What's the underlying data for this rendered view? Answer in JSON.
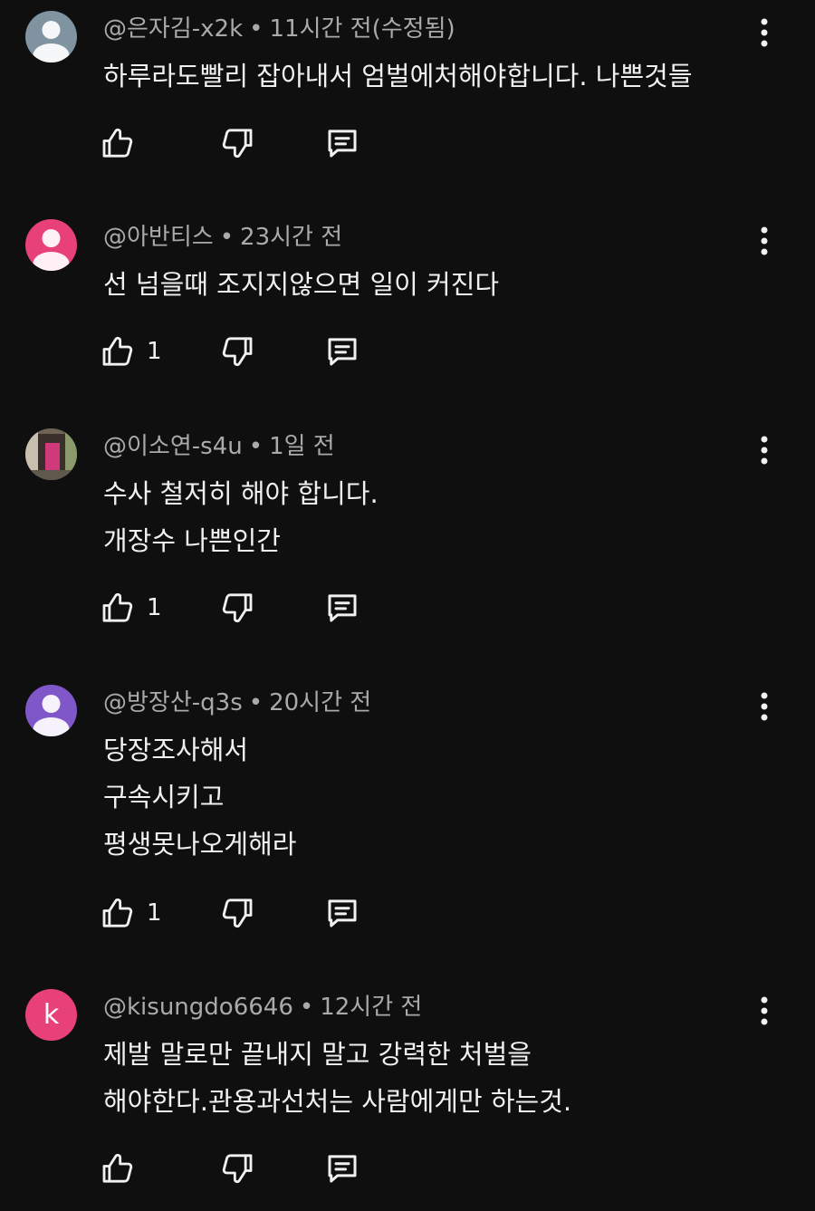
{
  "colors": {
    "background": "#0f0f0f",
    "text_primary": "#f1f1f1",
    "text_secondary": "#aaaaaa",
    "avatar_gray": "#7f93a0",
    "avatar_pink": "#e8417a",
    "avatar_purple": "#7f57c8"
  },
  "comments": [
    {
      "author": "@은자김-x2k",
      "separator": "•",
      "time": "11시간 전(수정됨)",
      "lines": [
        "하루라도빨리 잡아내서 엄벌에처해야합니다. 나쁜것들"
      ],
      "likes": "",
      "avatar": {
        "type": "default-person",
        "color": "#7f93a0"
      }
    },
    {
      "author": "@아반티스",
      "separator": "•",
      "time": "23시간 전",
      "lines": [
        "선 넘을때 조지지않으면 일이 커진다"
      ],
      "likes": "1",
      "avatar": {
        "type": "default-person",
        "color": "#e8417a"
      }
    },
    {
      "author": "@이소연-s4u",
      "separator": "•",
      "time": "1일 전",
      "lines": [
        "수사 철저히 해야 합니다.",
        "개장수 나쁜인간"
      ],
      "likes": "1",
      "avatar": {
        "type": "photo"
      }
    },
    {
      "author": "@방장산-q3s",
      "separator": "•",
      "time": "20시간 전",
      "lines": [
        "당장조사해서",
        "구속시키고",
        "평생못나오게해라"
      ],
      "likes": "1",
      "avatar": {
        "type": "default-person",
        "color": "#7f57c8"
      }
    },
    {
      "author": "@kisungdo6646",
      "separator": "•",
      "time": "12시간 전",
      "lines": [
        "제발 말로만 끝내지 말고 강력한 처벌을",
        "해야한다.관용과선처는 사람에게만 하는것."
      ],
      "likes": "",
      "avatar": {
        "type": "letter",
        "letter": "k",
        "color": "#e8417a"
      }
    }
  ],
  "icons": {
    "like": "thumb-up-icon",
    "dislike": "thumb-down-icon",
    "reply": "comment-reply-icon",
    "more": "more-vertical-icon"
  }
}
